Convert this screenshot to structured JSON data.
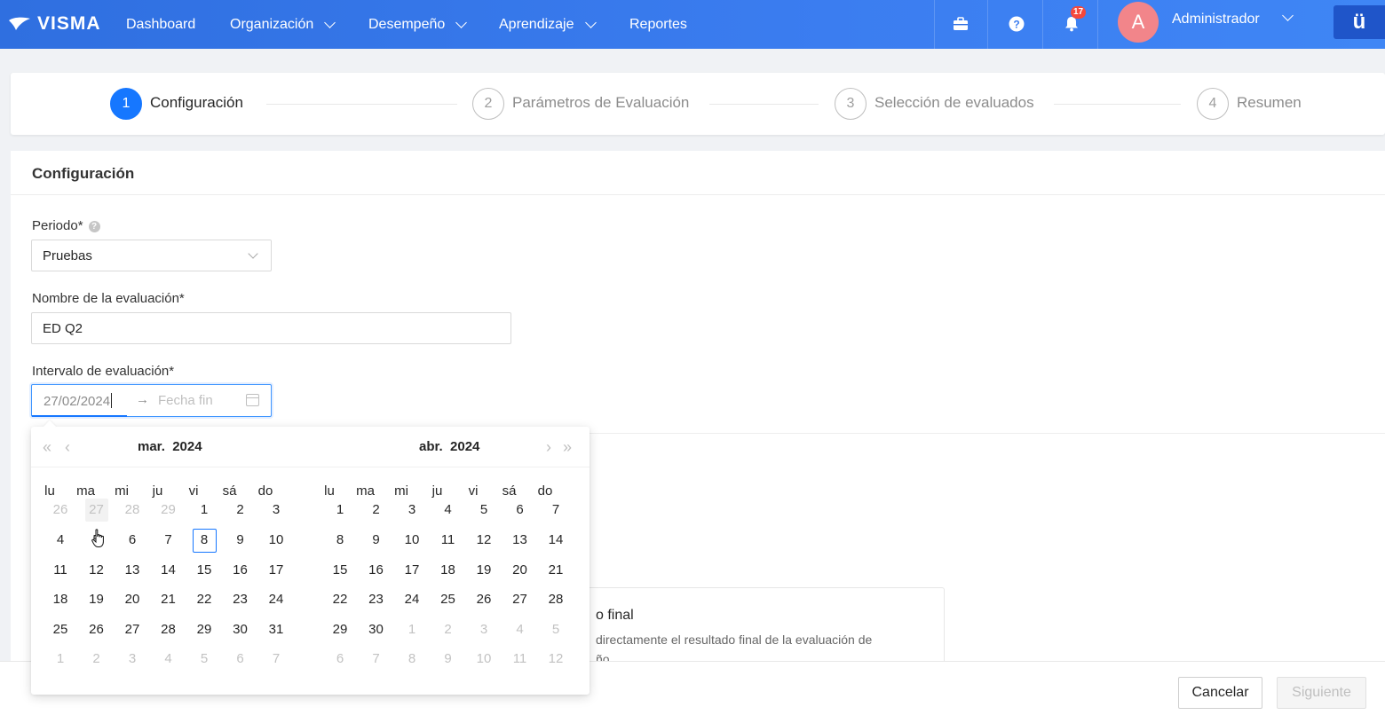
{
  "topbar": {
    "logo": "VISMA",
    "nav": [
      "Dashboard",
      "Organización",
      "Desempeño",
      "Aprendizaje",
      "Reportes"
    ],
    "notifications_count": "17",
    "avatar_initial": "A",
    "user_name": "Administrador",
    "app_button": "ü",
    "icons": [
      "briefcase-icon",
      "help-icon",
      "bell-icon"
    ]
  },
  "steps": [
    {
      "num": "1",
      "label": "Configuración"
    },
    {
      "num": "2",
      "label": "Parámetros de Evaluación"
    },
    {
      "num": "3",
      "label": "Selección de evaluados"
    },
    {
      "num": "4",
      "label": "Resumen"
    }
  ],
  "form": {
    "section_title": "Configuración",
    "period_label": "Periodo*",
    "period_value": "Pruebas",
    "name_label": "Nombre de la evaluación*",
    "name_value": "ED Q2",
    "interval_label": "Intervalo de evaluación*",
    "start_value": "27/02/2024",
    "end_placeholder": "Fecha fin"
  },
  "option": {
    "title": "o final",
    "desc_line1": "directamente el resultado final de la evaluación de",
    "desc_line2": "ño."
  },
  "footer": {
    "cancel": "Cancelar",
    "next": "Siguiente"
  },
  "calendar": {
    "weekdays": [
      "lu",
      "ma",
      "mi",
      "ju",
      "vi",
      "sá",
      "do"
    ],
    "left": {
      "month": "mar.",
      "year": "2024",
      "days": [
        [
          "26",
          "27",
          "28",
          "29",
          "1",
          "2",
          "3"
        ],
        [
          "4",
          "5",
          "6",
          "7",
          "8",
          "9",
          "10"
        ],
        [
          "11",
          "12",
          "13",
          "14",
          "15",
          "16",
          "17"
        ],
        [
          "18",
          "19",
          "20",
          "21",
          "22",
          "23",
          "24"
        ],
        [
          "25",
          "26",
          "27",
          "28",
          "29",
          "30",
          "31"
        ],
        [
          "1",
          "2",
          "3",
          "4",
          "5",
          "6",
          "7"
        ]
      ],
      "out_before": 4,
      "out_after_row": 5
    },
    "right": {
      "month": "abr.",
      "year": "2024",
      "days": [
        [
          "1",
          "2",
          "3",
          "4",
          "5",
          "6",
          "7"
        ],
        [
          "8",
          "9",
          "10",
          "11",
          "12",
          "13",
          "14"
        ],
        [
          "15",
          "16",
          "17",
          "18",
          "19",
          "20",
          "21"
        ],
        [
          "22",
          "23",
          "24",
          "25",
          "26",
          "27",
          "28"
        ],
        [
          "29",
          "30",
          "1",
          "2",
          "3",
          "4",
          "5"
        ],
        [
          "6",
          "7",
          "8",
          "9",
          "10",
          "11",
          "12"
        ]
      ]
    },
    "today": "8",
    "hover": "27"
  },
  "colors": {
    "brand": "#2f6fe0",
    "primary": "#1677ff",
    "badge": "#f5483b",
    "avatar": "#f2858a"
  }
}
